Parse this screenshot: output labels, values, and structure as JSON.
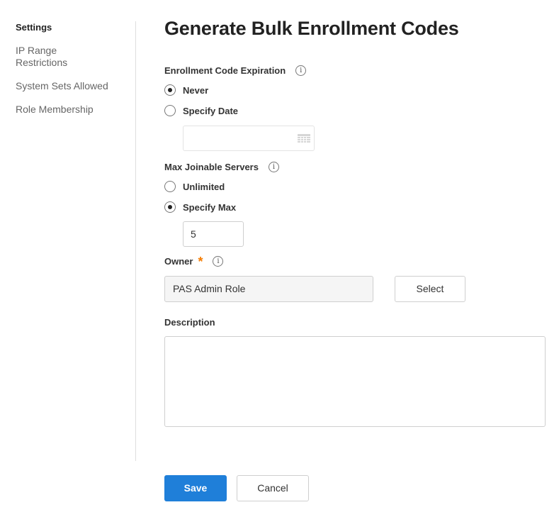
{
  "sidebar": {
    "items": [
      {
        "label": "Settings",
        "active": true
      },
      {
        "label": "IP Range Restrictions",
        "active": false
      },
      {
        "label": "System Sets Allowed",
        "active": false
      },
      {
        "label": "Role Membership",
        "active": false
      }
    ]
  },
  "page": {
    "title": "Generate Bulk Enrollment Codes"
  },
  "expiration": {
    "label": "Enrollment Code Expiration",
    "info_icon": "info-icon",
    "options": [
      {
        "label": "Never",
        "checked": true
      },
      {
        "label": "Specify Date",
        "checked": false
      }
    ],
    "date_value": "",
    "date_icon": "calendar-icon"
  },
  "max_servers": {
    "label": "Max Joinable Servers",
    "info_icon": "info-icon",
    "options": [
      {
        "label": "Unlimited",
        "checked": false
      },
      {
        "label": "Specify Max",
        "checked": true
      }
    ],
    "value": "5"
  },
  "owner": {
    "label": "Owner",
    "required_mark": "*",
    "info_icon": "info-icon",
    "value": "PAS Admin Role",
    "select_label": "Select"
  },
  "description": {
    "label": "Description",
    "value": ""
  },
  "actions": {
    "save_label": "Save",
    "cancel_label": "Cancel"
  },
  "colors": {
    "primary": "#1f7fd9",
    "required": "#f57c00",
    "divider": "#dedede"
  }
}
